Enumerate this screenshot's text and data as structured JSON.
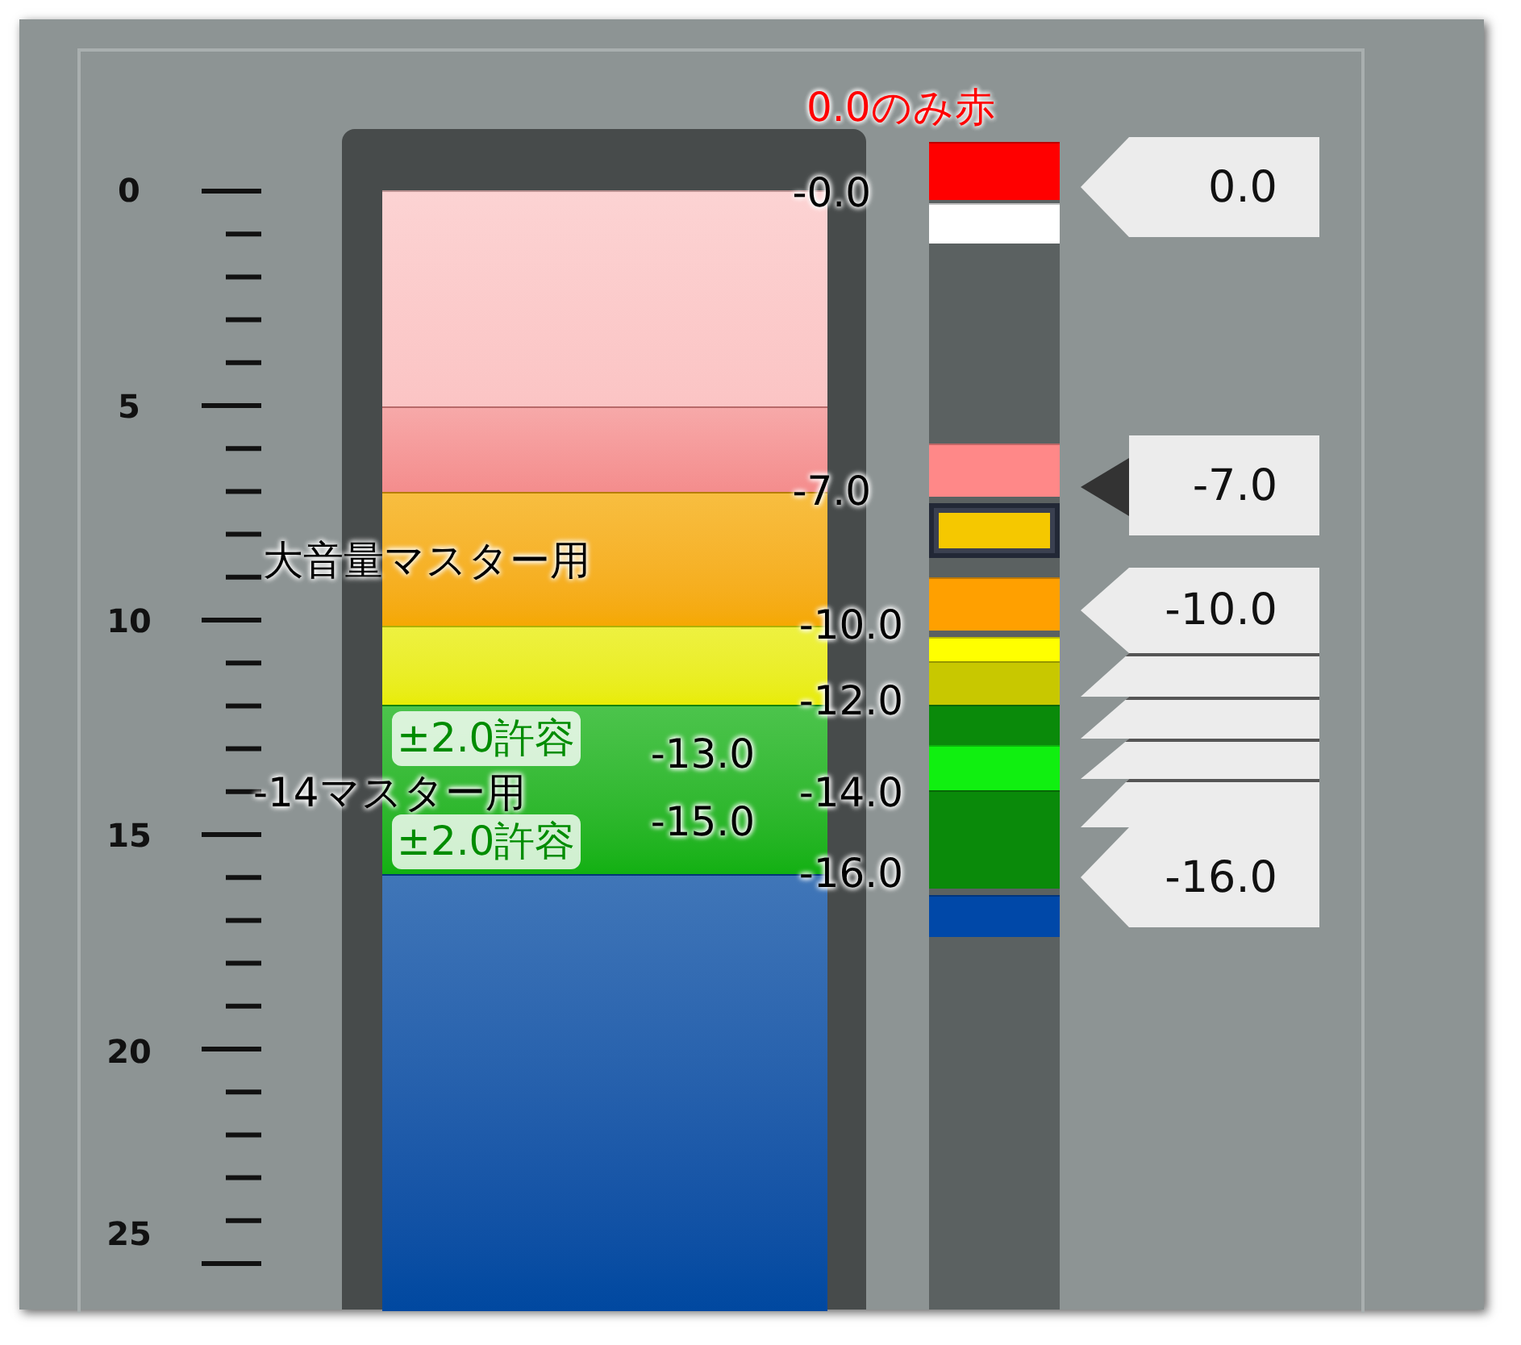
{
  "scale": {
    "labels": [
      "0",
      "5",
      "10",
      "15",
      "20",
      "25"
    ]
  },
  "meter": {
    "bands": [
      {
        "color": "#fbc4c4"
      },
      {
        "color": "#f48c8c"
      },
      {
        "color": "#f5a800"
      },
      {
        "color": "#e8ec00"
      },
      {
        "color": "#10b010"
      },
      {
        "color": "#0048a0"
      }
    ]
  },
  "header": "0.0のみ赤",
  "annotations": [
    {
      "text": "-0.0",
      "kind": "level"
    },
    {
      "text": "-7.0",
      "kind": "level"
    },
    {
      "text": "大音量マスター用",
      "kind": "label"
    },
    {
      "text": "-10.0",
      "kind": "level"
    },
    {
      "text": "-12.0",
      "kind": "level"
    },
    {
      "text": "±2.0許容",
      "kind": "tolerance"
    },
    {
      "text": "-13.0",
      "kind": "level"
    },
    {
      "text": "-14マスター用",
      "kind": "label"
    },
    {
      "text": "-14.0",
      "kind": "level"
    },
    {
      "text": "-15.0",
      "kind": "level"
    },
    {
      "text": "±2.0許容",
      "kind": "tolerance"
    },
    {
      "text": "-16.0",
      "kind": "level"
    }
  ],
  "strip": {
    "segments": [
      {
        "kind": "band",
        "color": "#ff0000"
      },
      {
        "kind": "band",
        "color": "#ffffff"
      },
      {
        "kind": "band",
        "color": "#ff8888"
      },
      {
        "kind": "marker",
        "color": "#f5c800"
      },
      {
        "kind": "band",
        "color": "#ffa000"
      },
      {
        "kind": "band",
        "color": "#ffff00"
      },
      {
        "kind": "band",
        "color": "#c8c800"
      },
      {
        "kind": "band",
        "color": "#0a8a0a"
      },
      {
        "kind": "band",
        "color": "#10f010"
      },
      {
        "kind": "band",
        "color": "#0a8a0a"
      },
      {
        "kind": "band",
        "color": "#0048a8"
      }
    ]
  },
  "tags": [
    {
      "kind": "visible",
      "label": "0.0",
      "selected": false
    },
    {
      "kind": "visible",
      "label": "-7.0",
      "selected": true
    },
    {
      "kind": "visible",
      "label": "-10.0",
      "selected": false
    },
    {
      "kind": "covered"
    },
    {
      "kind": "covered"
    },
    {
      "kind": "covered"
    },
    {
      "kind": "covered"
    },
    {
      "kind": "visible",
      "label": "-16.0",
      "selected": false
    }
  ]
}
